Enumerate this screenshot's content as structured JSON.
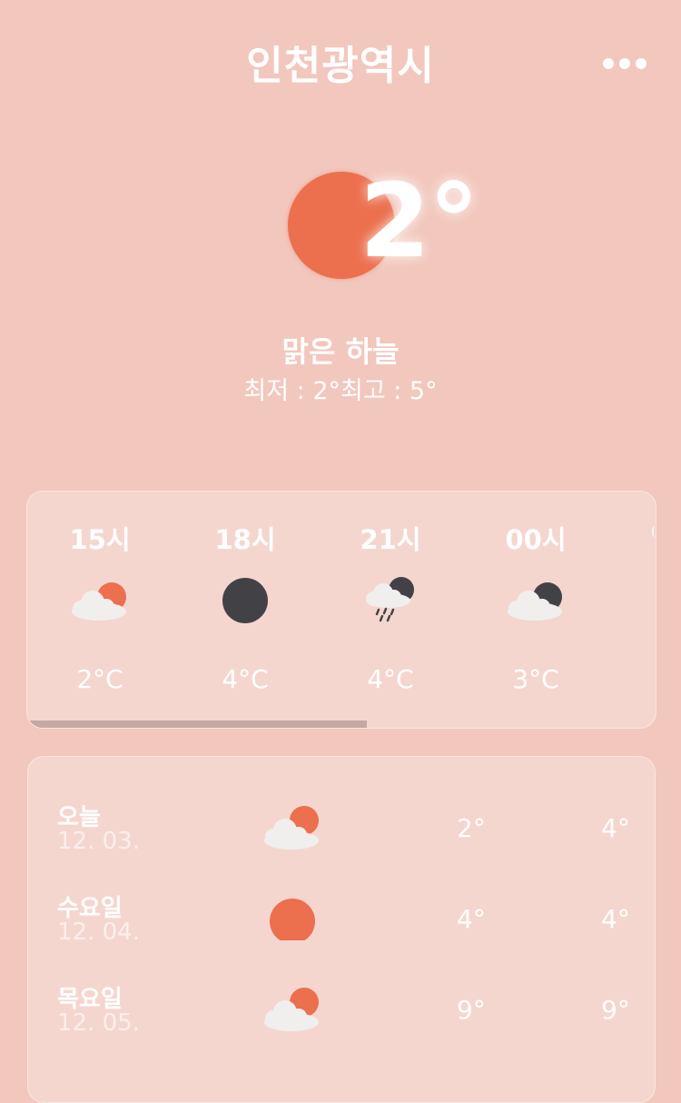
{
  "header": {
    "city": "인천광역시",
    "more_icon": "more-dots-icon"
  },
  "current": {
    "temp": "2°",
    "condition": "맑은 하늘",
    "minmax": "최저 : 2°최고 : 5°",
    "icon": "sun-icon",
    "colors": {
      "background": "#f2c7bd",
      "sun": "#ec6f4e",
      "moon": "#424246"
    }
  },
  "hourly": [
    {
      "time": "15시",
      "icon": "partly-cloudy-day-icon",
      "temp": "2°C"
    },
    {
      "time": "18시",
      "icon": "moon-icon",
      "temp": "4°C"
    },
    {
      "time": "21시",
      "icon": "rain-night-icon",
      "temp": "4°C"
    },
    {
      "time": "00시",
      "icon": "partly-cloudy-night-icon",
      "temp": "3°C"
    }
  ],
  "hourly_scroll_progress": 0.54,
  "daily": [
    {
      "day": "오늘",
      "date": "12. 03.",
      "icon": "partly-cloudy-day-icon",
      "low": "2°",
      "high": "4°"
    },
    {
      "day": "수요일",
      "date": "12. 04.",
      "icon": "sun-icon",
      "low": "4°",
      "high": "4°"
    },
    {
      "day": "목요일",
      "date": "12. 05.",
      "icon": "partly-cloudy-day-icon",
      "low": "9°",
      "high": "9°"
    }
  ]
}
